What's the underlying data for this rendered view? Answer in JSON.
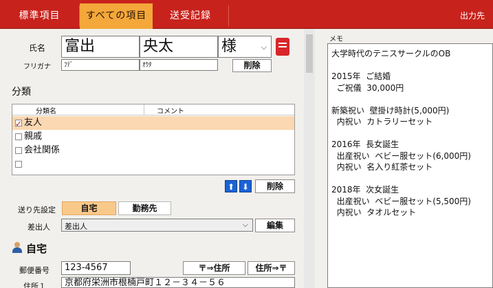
{
  "tabs": [
    {
      "label": "標準項目",
      "active": false
    },
    {
      "label": "すべての項目",
      "active": true
    },
    {
      "label": "送受記録",
      "active": false
    }
  ],
  "tab_right": "出力先",
  "name": {
    "label": "氏名",
    "last": "富出",
    "first": "央太",
    "honorific": "様",
    "furigana_label": "フリガナ",
    "furigana_last": "ﾌﾃﾞ",
    "furigana_first": "ｵｳﾀ",
    "delete_label": "削除"
  },
  "classification": {
    "title": "分類",
    "col_name": "分類名",
    "col_comment": "コメント",
    "items": [
      {
        "label": "友人",
        "checked": true,
        "selected": true
      },
      {
        "label": "親戚",
        "checked": false,
        "selected": false
      },
      {
        "label": "会社関係",
        "checked": false,
        "selected": false
      },
      {
        "label": "",
        "checked": false,
        "selected": false
      }
    ],
    "up_icon": "up-arrow-icon",
    "down_icon": "down-arrow-icon",
    "delete_label": "削除"
  },
  "sending": {
    "label": "送り先設定",
    "home_label": "自宅",
    "work_label": "勤務先",
    "sender_label": "差出人",
    "sender_value": "差出人",
    "edit_label": "編集"
  },
  "home": {
    "title": "自宅",
    "postal_label": "郵便番号",
    "postal_value": "123-4567",
    "to_address_btn": "〒⇒住所",
    "to_postal_btn": "住所⇒〒",
    "address1_label": "住所１",
    "address1_value": "京都府栄洲市根楠戸町１２－３４－５６"
  },
  "memo": {
    "label": "メモ",
    "text": "大学時代のテニスサークルのOB\n\n2015年  ご結婚\n  ご祝儀  30,000円\n\n新築祝い  壁掛け時計(5,000円)\n  内祝い  カトラリーセット\n\n2016年  長女誕生\n  出産祝い  ベビー服セット(6,000円)\n  内祝い  名入り紅茶セット\n\n2018年  次女誕生\n  出産祝い  ベビー服セット(5,500円)\n  内祝い  タオルセット"
  },
  "colors": {
    "accent": "#c8221c",
    "active_tab": "#f4a73a",
    "selection": "#fbd8b2",
    "arrow": "#1a63d6"
  }
}
